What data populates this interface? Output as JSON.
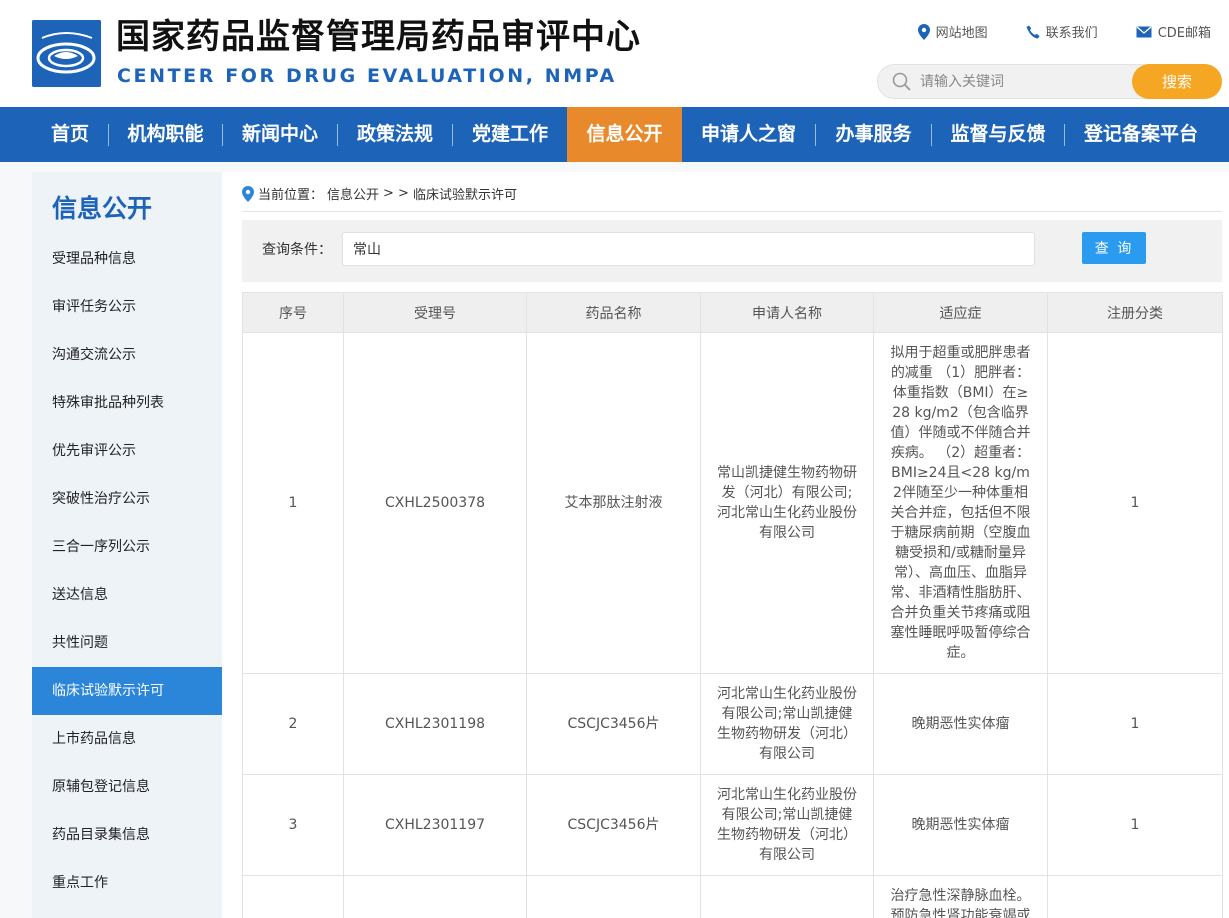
{
  "site": {
    "title": "国家药品监督管理局药品审评中心",
    "subtitle": "CENTER FOR DRUG EVALUATION, NMPA",
    "brand_color": "#1d64b8",
    "accent_color": "#e8892c"
  },
  "top_links": [
    {
      "label": "网站地图",
      "icon": "location-pin-icon"
    },
    {
      "label": "联系我们",
      "icon": "phone-icon"
    },
    {
      "label": "CDE邮箱",
      "icon": "mail-icon"
    }
  ],
  "search": {
    "placeholder": "请输入关键词",
    "button_label": "搜索"
  },
  "nav": {
    "items": [
      "首页",
      "机构职能",
      "新闻中心",
      "政策法规",
      "党建工作",
      "信息公开",
      "申请人之窗",
      "办事服务",
      "监督与反馈",
      "登记备案平台"
    ],
    "active": "信息公开"
  },
  "sidebar": {
    "title": "信息公开",
    "items": [
      "受理品种信息",
      "审评任务公示",
      "沟通交流公示",
      "特殊审批品种列表",
      "优先审评公示",
      "突破性治疗公示",
      "三合一序列公示",
      "送达信息",
      "共性问题",
      "临床试验默示许可",
      "上市药品信息",
      "原辅包登记信息",
      "药品目录集信息",
      "重点工作"
    ],
    "active": "临床试验默示许可"
  },
  "breadcrumb": {
    "prefix": "当前位置：",
    "section": "信息公开",
    "separator": "> >",
    "current": "临床试验默示许可"
  },
  "query": {
    "label": "查询条件：",
    "value": "常山",
    "button_label": "查 询"
  },
  "table": {
    "headers": [
      "序号",
      "受理号",
      "药品名称",
      "申请人名称",
      "适应症",
      "注册分类"
    ],
    "rows": [
      {
        "no": "1",
        "acceptance_no": "CXHL2500378",
        "drug_name": "艾本那肽注射液",
        "applicant": "常山凯捷健生物药物研发（河北）有限公司;河北常山生化药业股份有限公司",
        "indication": "拟用于超重或肥胖患者的减重 （1）肥胖者：体重指数（BMI）在≥28 kg/m2（包含临界值）伴随或不伴随合并疾病。 （2）超重者：BMI≥24且<28 kg/m2伴随至少一种体重相关合并症，包括但不限于糖尿病前期（空腹血糖受损和/或糖耐量异常）、高血压、血脂异常、非酒精性脂肪肝、合并负重关节疼痛或阻塞性睡眠呼吸暂停综合症。",
        "category": "1"
      },
      {
        "no": "2",
        "acceptance_no": "CXHL2301198",
        "drug_name": "CSCJC3456片",
        "applicant": "河北常山生化药业股份有限公司;常山凯捷健生物药物研发（河北）有限公司",
        "indication": "晚期恶性实体瘤",
        "category": "1"
      },
      {
        "no": "3",
        "acceptance_no": "CXHL2301197",
        "drug_name": "CSCJC3456片",
        "applicant": "河北常山生化药业股份有限公司;常山凯捷健生物药物研发（河北）有限公司",
        "indication": "晚期恶性实体瘤",
        "category": "1"
      },
      {
        "no": "",
        "acceptance_no": "",
        "drug_name": "",
        "applicant": "",
        "indication": "治疗急性深静脉血栓。预防急性肾功能衰竭或",
        "category": ""
      }
    ]
  }
}
